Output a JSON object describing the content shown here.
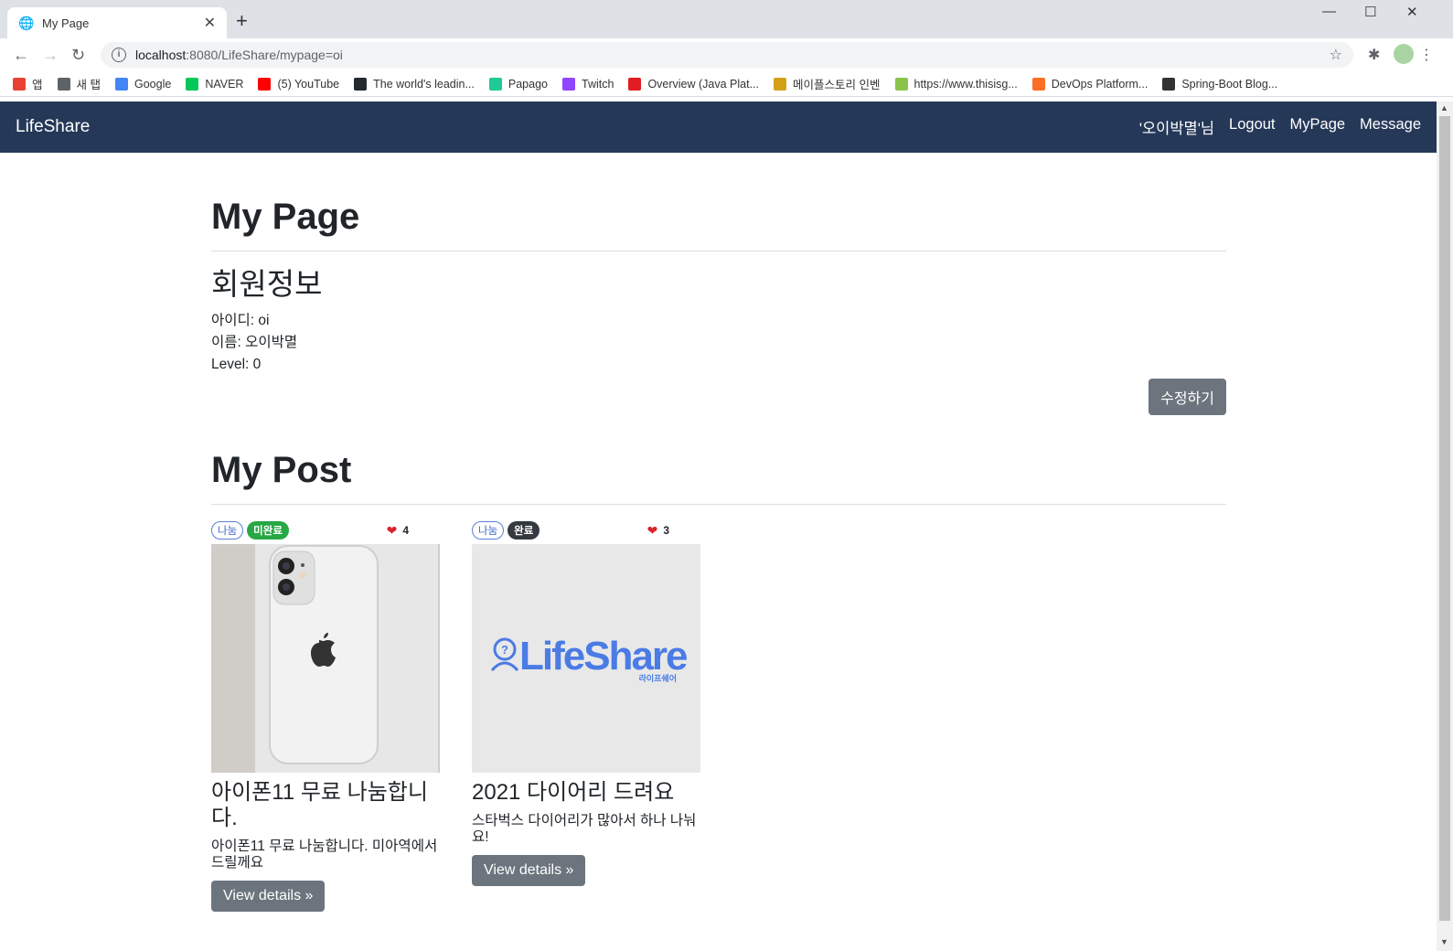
{
  "browser": {
    "tab_title": "My Page",
    "url_host": "localhost",
    "url_path": ":8080/LifeShare/mypage=oi",
    "bookmarks": [
      {
        "label": "앱",
        "color": "#e94235"
      },
      {
        "label": "새 탭",
        "color": "#5f6368"
      },
      {
        "label": "Google",
        "color": "#4285f4"
      },
      {
        "label": "NAVER",
        "color": "#03c75a"
      },
      {
        "label": "(5) YouTube",
        "color": "#ff0000"
      },
      {
        "label": "The world's leadin...",
        "color": "#24292e"
      },
      {
        "label": "Papago",
        "color": "#20c997"
      },
      {
        "label": "Twitch",
        "color": "#9146ff"
      },
      {
        "label": "Overview (Java Plat...",
        "color": "#e31b23"
      },
      {
        "label": "메이플스토리 인벤",
        "color": "#d4a017"
      },
      {
        "label": "https://www.thisisg...",
        "color": "#8bc34a"
      },
      {
        "label": "DevOps Platform...",
        "color": "#fc6d26"
      },
      {
        "label": "Spring-Boot Blog...",
        "color": "#333333"
      }
    ]
  },
  "navbar": {
    "brand": "LifeShare",
    "user_greeting": "'오이박멸'님",
    "logout": "Logout",
    "mypage": "MyPage",
    "message": "Message",
    "bg_color": "#253858"
  },
  "mypage": {
    "title": "My Page",
    "member_info_heading": "회원정보",
    "id_line": "아이디: oi",
    "name_line": "이름: 오이박멸",
    "level_line": "Level: 0",
    "edit_button": "수정하기"
  },
  "mypost": {
    "title": "My Post",
    "posts": [
      {
        "category": "나눔",
        "status": "미완료",
        "status_color": "#28a745",
        "likes": "4",
        "title": "아이폰11 무료 나눔합니다.",
        "desc": "아이폰11 무료 나눔합니다. 미아역에서 드릴께요",
        "button": "View details »"
      },
      {
        "category": "나눔",
        "status": "완료",
        "status_color": "#343a40",
        "likes": "3",
        "title": "2021 다이어리 드려요",
        "desc": "스타벅스 다이어리가 많아서 하나 나눠요!",
        "button": "View details »",
        "image_logo_text": "LifeShare",
        "image_logo_sub": "라이프쉐어"
      }
    ]
  }
}
